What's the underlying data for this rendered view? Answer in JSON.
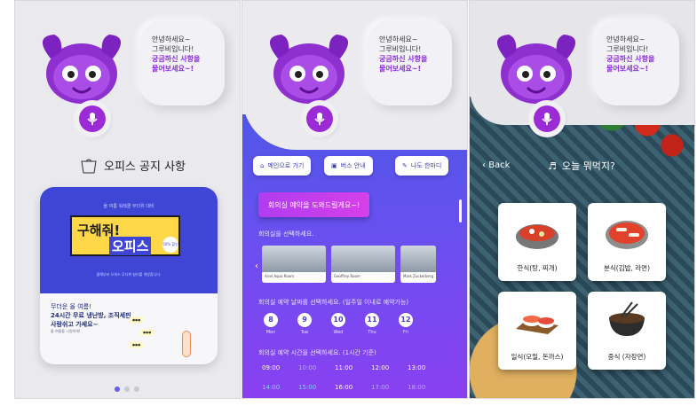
{
  "mascot": {
    "greeting_line1": "안녕하세요~",
    "greeting_line2": "그루비입니다!",
    "question_line1": "궁금하신 사항을",
    "question_line2": "물어보세요~!"
  },
  "panel1": {
    "title": "오피스 공지 사항",
    "poster": {
      "kicker": "올 여름 워레클 무더위 대비",
      "headline1": "구해줘!",
      "headline2": "오피스",
      "stamp": "50% 할인",
      "desc": "올해부터 오피스 무더위 쉼터를 개방합니다.",
      "bottom_line1": "무더운 올 여름!",
      "bottom_line2": "24시간 무료 냉난방, 조직세핀",
      "bottom_line3": "사랑쉬고 가세요~",
      "bottom_small": "올 여름을 시원하게!"
    },
    "pager": {
      "count": 3,
      "active": 0
    }
  },
  "panel2": {
    "quick_buttons": [
      "메인으로 가기",
      "버스 안내",
      "나도 한마디"
    ],
    "cta": "회의실 예약을 도와드릴게요~!",
    "room_section": "회의실을 선택하세요.",
    "rooms": [
      "Ariel Aqua Room",
      "Geoffrey Room",
      "Mark Zuckerberg"
    ],
    "date_section": "회의실 예약 날짜를 선택하세요. (일주일 이내로 예약가능)",
    "days": [
      {
        "num": "8",
        "wd": "Mon"
      },
      {
        "num": "9",
        "wd": "Tue"
      },
      {
        "num": "10",
        "wd": "Wed"
      },
      {
        "num": "11",
        "wd": "Thu"
      },
      {
        "num": "12",
        "wd": "Fri"
      }
    ],
    "time_section": "회의실 예약 시간을 선택하세요. (1시간 기준)",
    "times_row1": [
      "09:00",
      "10:00",
      "11:00",
      "12:00",
      "13:00"
    ],
    "times_row2": [
      "14:00",
      "15:00",
      "16:00",
      "17:00",
      "18:00"
    ]
  },
  "panel3": {
    "back": "Back",
    "question": "오늘 뭐먹지?",
    "foods": [
      "한식(탕, 찌개)",
      "분식(김밥, 라면)",
      "일식(모밀, 돈까스)",
      "중식 (자장면)"
    ]
  },
  "colors": {
    "purple": "#9b2bd6",
    "indigo": "#4f57e8",
    "poster_blue": "#3f46d6",
    "highlight": "#ffd84a"
  }
}
